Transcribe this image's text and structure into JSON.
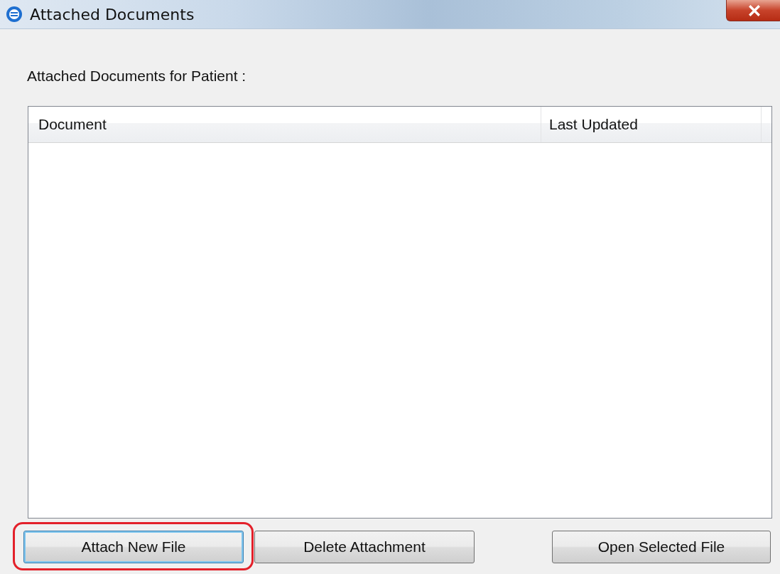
{
  "window": {
    "title": "Attached Documents"
  },
  "label": "Attached Documents for Patient :",
  "table": {
    "columns": [
      "Document",
      "Last Updated"
    ]
  },
  "buttons": [
    {
      "label": "Attach New File",
      "highlighted": true,
      "focused": true
    },
    {
      "label": "Delete Attachment",
      "highlighted": false,
      "focused": false
    },
    {
      "label": "Open Selected File",
      "highlighted": false,
      "focused": false
    }
  ]
}
